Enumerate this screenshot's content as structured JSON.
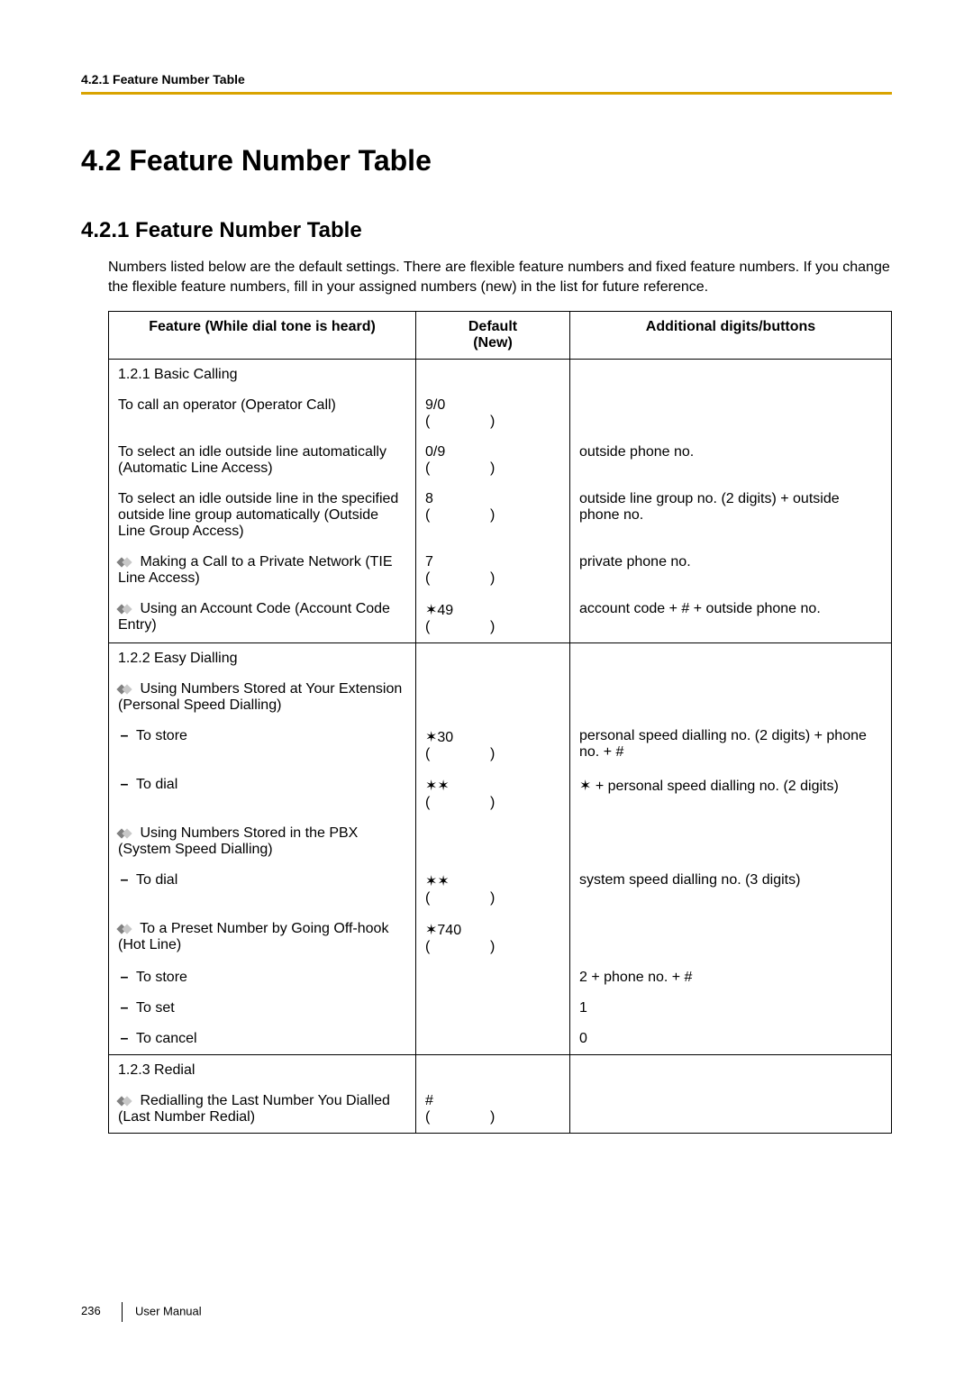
{
  "header": {
    "running": "4.2.1 Feature Number Table"
  },
  "section": {
    "title": "4.2  Feature Number Table"
  },
  "subsection": {
    "title": "4.2.1  Feature Number Table"
  },
  "intro": "Numbers listed below are the default settings. There are flexible feature numbers and fixed feature numbers. If you change the flexible feature numbers, fill in your assigned numbers (new) in the list for future reference.",
  "table": {
    "headers": {
      "feature": "Feature (While dial tone is heard)",
      "default_line1": "Default",
      "default_line2": "(New)",
      "additional": "Additional digits/buttons"
    }
  },
  "rows": {
    "r0": {
      "feature": "1.2.1  Basic Calling",
      "default": "",
      "additional": ""
    },
    "r1": {
      "feature": "To call an operator (Operator Call)",
      "default": "9/0\n(               )",
      "additional": ""
    },
    "r2": {
      "feature": "To select an idle outside line automatically (Automatic Line Access)",
      "default": "0/9\n(               )",
      "additional": "outside phone no."
    },
    "r3": {
      "feature": "To select an idle outside line in the specified outside line group automatically (Outside Line Group Access)",
      "default": "8\n(               )",
      "additional": "outside line group no. (2 digits) + outside phone no."
    },
    "r4": {
      "feature": " Making a Call to a Private Network (TIE Line Access)",
      "default": "7\n(               )",
      "additional": "private phone no."
    },
    "r5": {
      "feature": " Using an Account Code (Account Code Entry)",
      "default": "✶49\n(               )",
      "additional": "account code + # + outside phone no."
    },
    "r6": {
      "feature": "1.2.2  Easy Dialling",
      "default": "",
      "additional": ""
    },
    "r7": {
      "feature": " Using Numbers Stored at Your Extension (Personal Speed Dialling)",
      "default": "",
      "additional": ""
    },
    "r8": {
      "feature": "To store",
      "default": "✶30\n(               )",
      "additional": "personal speed dialling no. (2 digits) + phone no. + #"
    },
    "r9": {
      "feature": "To dial",
      "default": "✶✶\n(               )",
      "additional": "✶ + personal speed dialling no. (2 digits)"
    },
    "r10": {
      "feature": " Using Numbers Stored in the PBX (System Speed Dialling)",
      "default": "",
      "additional": ""
    },
    "r11": {
      "feature": "To dial",
      "default": "✶✶\n(               )",
      "additional": "system speed dialling no. (3 digits)"
    },
    "r12": {
      "feature": " To a Preset Number by Going Off-hook (Hot Line)",
      "default": "✶740\n(               )",
      "additional": ""
    },
    "r13": {
      "feature": "To store",
      "default": "",
      "additional": "2 + phone no. + #"
    },
    "r14": {
      "feature": "To set",
      "default": "",
      "additional": "1"
    },
    "r15": {
      "feature": "To cancel",
      "default": "",
      "additional": "0"
    },
    "r16": {
      "feature": "1.2.3  Redial",
      "default": "",
      "additional": ""
    },
    "r17": {
      "feature": " Redialling the Last Number You Dialled (Last Number Redial)",
      "default": "#\n(               )",
      "additional": ""
    }
  },
  "footer": {
    "page": "236",
    "label": "User Manual"
  }
}
